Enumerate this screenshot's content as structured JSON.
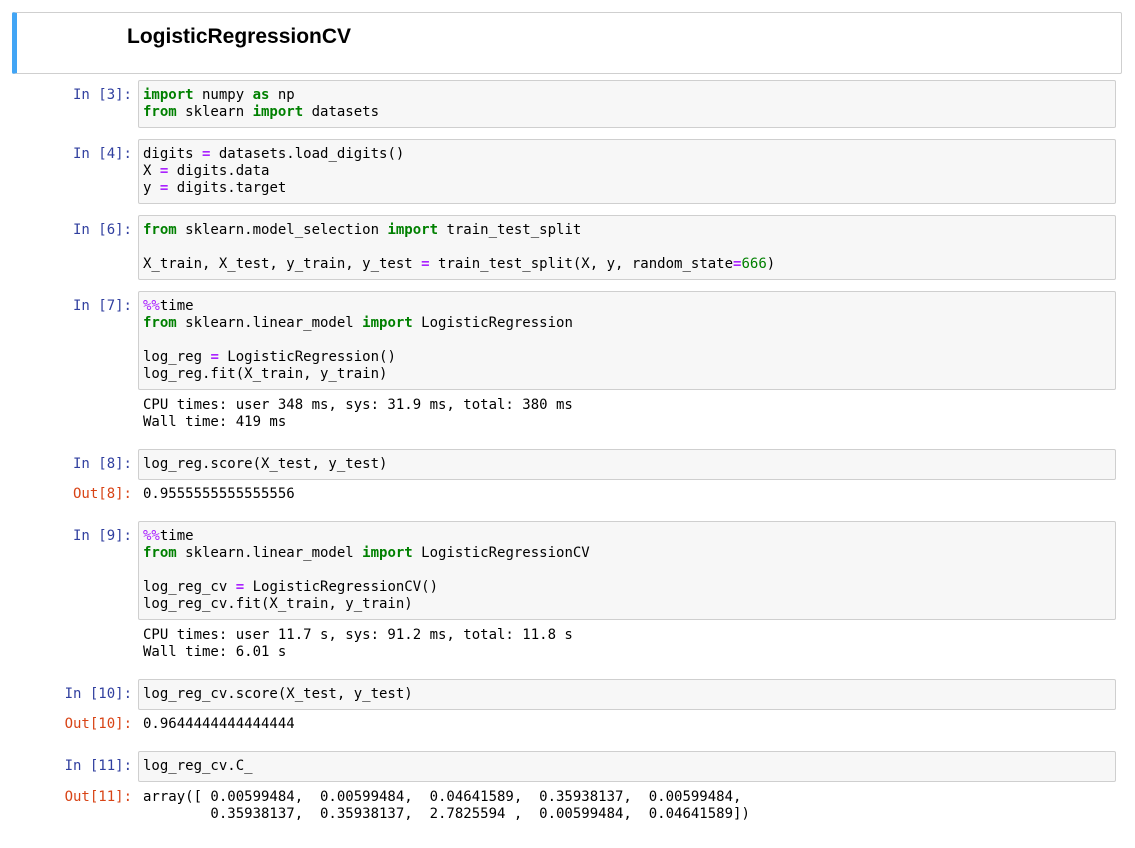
{
  "heading": "LogisticRegressionCV",
  "cells": [
    {
      "prompt": "In [3]:",
      "lines": [
        [
          {
            "t": "import",
            "c": "kw"
          },
          {
            "t": " numpy "
          },
          {
            "t": "as",
            "c": "kw"
          },
          {
            "t": " np"
          }
        ],
        [
          {
            "t": "from",
            "c": "kw"
          },
          {
            "t": " sklearn "
          },
          {
            "t": "import",
            "c": "kw"
          },
          {
            "t": " datasets"
          }
        ]
      ]
    },
    {
      "prompt": "In [4]:",
      "lines": [
        [
          {
            "t": "digits "
          },
          {
            "t": "=",
            "c": "op"
          },
          {
            "t": " datasets.load_digits()"
          }
        ],
        [
          {
            "t": "X "
          },
          {
            "t": "=",
            "c": "op"
          },
          {
            "t": " digits.data"
          }
        ],
        [
          {
            "t": "y "
          },
          {
            "t": "=",
            "c": "op"
          },
          {
            "t": " digits.target"
          }
        ]
      ]
    },
    {
      "prompt": "In [6]:",
      "lines": [
        [
          {
            "t": "from",
            "c": "kw"
          },
          {
            "t": " sklearn.model_selection "
          },
          {
            "t": "import",
            "c": "kw"
          },
          {
            "t": " train_test_split"
          }
        ],
        [],
        [
          {
            "t": "X_train, X_test, y_train, y_test "
          },
          {
            "t": "=",
            "c": "op"
          },
          {
            "t": " train_test_split(X, y, random_state"
          },
          {
            "t": "=",
            "c": "op"
          },
          {
            "t": "666",
            "c": "num"
          },
          {
            "t": ")"
          }
        ]
      ]
    },
    {
      "prompt": "In [7]:",
      "lines": [
        [
          {
            "t": "%%",
            "c": "magic"
          },
          {
            "t": "time"
          }
        ],
        [
          {
            "t": "from",
            "c": "kw"
          },
          {
            "t": " sklearn.linear_model "
          },
          {
            "t": "import",
            "c": "kw"
          },
          {
            "t": " LogisticRegression"
          }
        ],
        [],
        [
          {
            "t": "log_reg "
          },
          {
            "t": "=",
            "c": "op"
          },
          {
            "t": " LogisticRegression()"
          }
        ],
        [
          {
            "t": "log_reg.fit(X_train, y_train)"
          }
        ]
      ],
      "stream": [
        "CPU times: user 348 ms, sys: 31.9 ms, total: 380 ms",
        "Wall time: 419 ms"
      ]
    },
    {
      "prompt": "In [8]:",
      "lines": [
        [
          {
            "t": "log_reg.score(X_test, y_test)"
          }
        ]
      ],
      "out_prompt": "Out[8]:",
      "result": [
        "0.9555555555555556"
      ]
    },
    {
      "prompt": "In [9]:",
      "lines": [
        [
          {
            "t": "%%",
            "c": "magic"
          },
          {
            "t": "time"
          }
        ],
        [
          {
            "t": "from",
            "c": "kw"
          },
          {
            "t": " sklearn.linear_model "
          },
          {
            "t": "import",
            "c": "kw"
          },
          {
            "t": " LogisticRegressionCV"
          }
        ],
        [],
        [
          {
            "t": "log_reg_cv "
          },
          {
            "t": "=",
            "c": "op"
          },
          {
            "t": " LogisticRegressionCV()"
          }
        ],
        [
          {
            "t": "log_reg_cv.fit(X_train, y_train)"
          }
        ]
      ],
      "stream": [
        "CPU times: user 11.7 s, sys: 91.2 ms, total: 11.8 s",
        "Wall time: 6.01 s"
      ]
    },
    {
      "prompt": "In [10]:",
      "lines": [
        [
          {
            "t": "log_reg_cv.score(X_test, y_test)"
          }
        ]
      ],
      "out_prompt": "Out[10]:",
      "result": [
        "0.9644444444444444"
      ]
    },
    {
      "prompt": "In [11]:",
      "lines": [
        [
          {
            "t": "log_reg_cv.C_"
          }
        ]
      ],
      "out_prompt": "Out[11]:",
      "result": [
        "array([ 0.00599484,  0.00599484,  0.04641589,  0.35938137,  0.00599484,",
        "        0.35938137,  0.35938137,  2.7825594 ,  0.00599484,  0.04641589])"
      ]
    }
  ]
}
